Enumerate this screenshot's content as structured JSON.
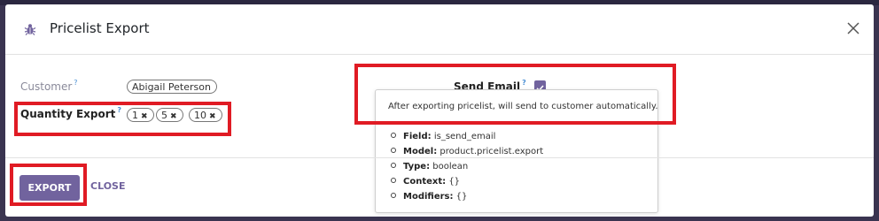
{
  "dialog": {
    "title": "Pricelist Export",
    "icons": {
      "title_icon": "bug-icon",
      "close_icon": "close-icon"
    }
  },
  "form": {
    "customer": {
      "label": "Customer",
      "help": "?",
      "tag": "Abigail Peterson"
    },
    "quantity_export": {
      "label": "Quantity Export",
      "help": "?",
      "tags": [
        {
          "label": "1",
          "remove": "✖"
        },
        {
          "label": "5",
          "remove": "✖"
        },
        {
          "label": "10",
          "remove": "✖"
        }
      ]
    },
    "send_email": {
      "label": "Send Email",
      "help": "?",
      "checked": true
    }
  },
  "tooltip": {
    "description": "After exporting pricelist, will send to customer automatically.",
    "items": [
      {
        "key": "Field:",
        "value": "is_send_email"
      },
      {
        "key": "Model:",
        "value": "product.pricelist.export"
      },
      {
        "key": "Type:",
        "value": "boolean"
      },
      {
        "key": "Context:",
        "value": "{}"
      },
      {
        "key": "Modifiers:",
        "value": "{}"
      }
    ]
  },
  "footer": {
    "export_label": "EXPORT",
    "close_label": "CLOSE"
  },
  "colors": {
    "accent": "#71639e",
    "highlight": "#e01b24",
    "help": "#4a8fd4",
    "backdrop": "#3a3450"
  }
}
